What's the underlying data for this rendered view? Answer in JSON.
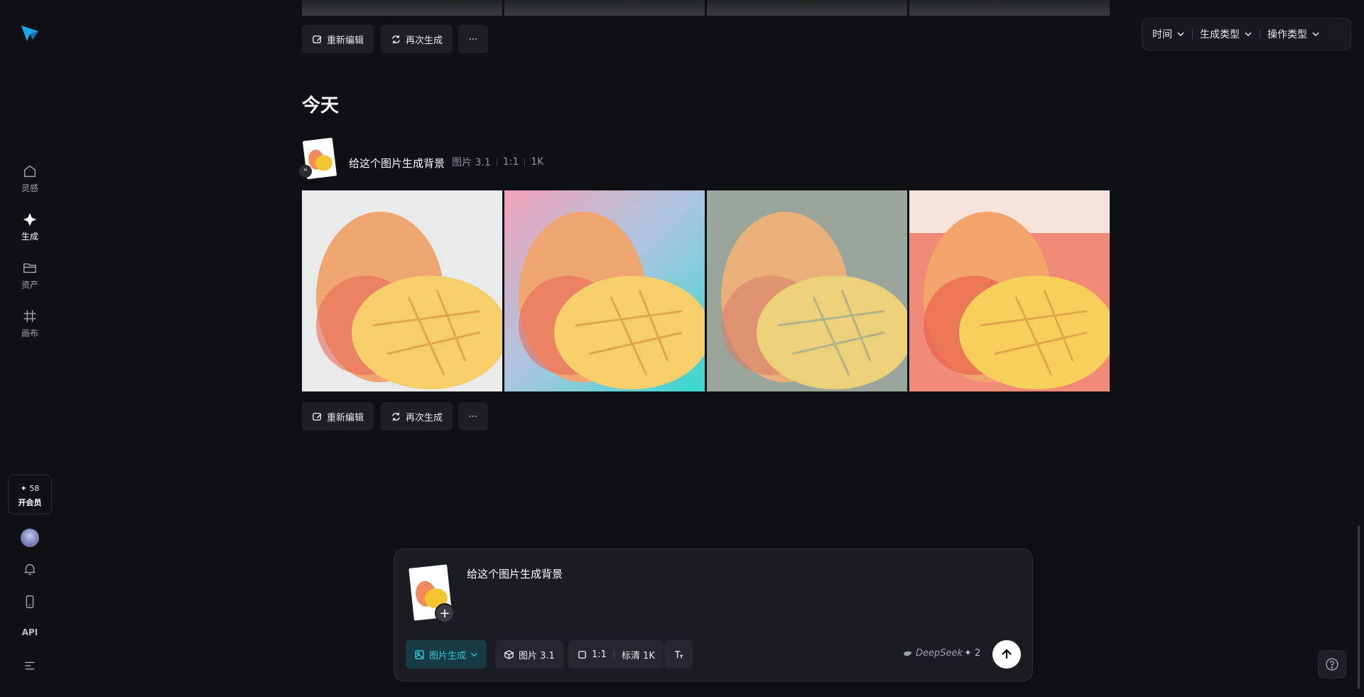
{
  "sidebar": {
    "items": [
      {
        "label": "灵感",
        "icon": "home-icon"
      },
      {
        "label": "生成",
        "icon": "sparkle-icon"
      },
      {
        "label": "资产",
        "icon": "folder-icon"
      },
      {
        "label": "画布",
        "icon": "canvas-icon"
      }
    ],
    "credits": "✦ 58",
    "vip_label": "开会员",
    "api_label": "API"
  },
  "filters": {
    "time": "时间",
    "gen_type": "生成类型",
    "op_type": "操作类型"
  },
  "actions": {
    "reedit": "重新编辑",
    "regenerate": "再次生成",
    "more": "⋯"
  },
  "feed": {
    "section_title": "今天",
    "generation": {
      "prompt": "给这个图片生成背景",
      "model": "图片 3.1",
      "ratio": "1:1",
      "resolution": "1K"
    }
  },
  "composer": {
    "prompt": "给这个图片生成背景",
    "mode": "图片生成",
    "model": "图片 3.1",
    "ratio": "1:1",
    "quality": "标清 1K",
    "provider": "DeepSeek",
    "cost": "✦ 2"
  },
  "colors": {
    "accent": "#29c7d9",
    "background": "#0f1014"
  }
}
